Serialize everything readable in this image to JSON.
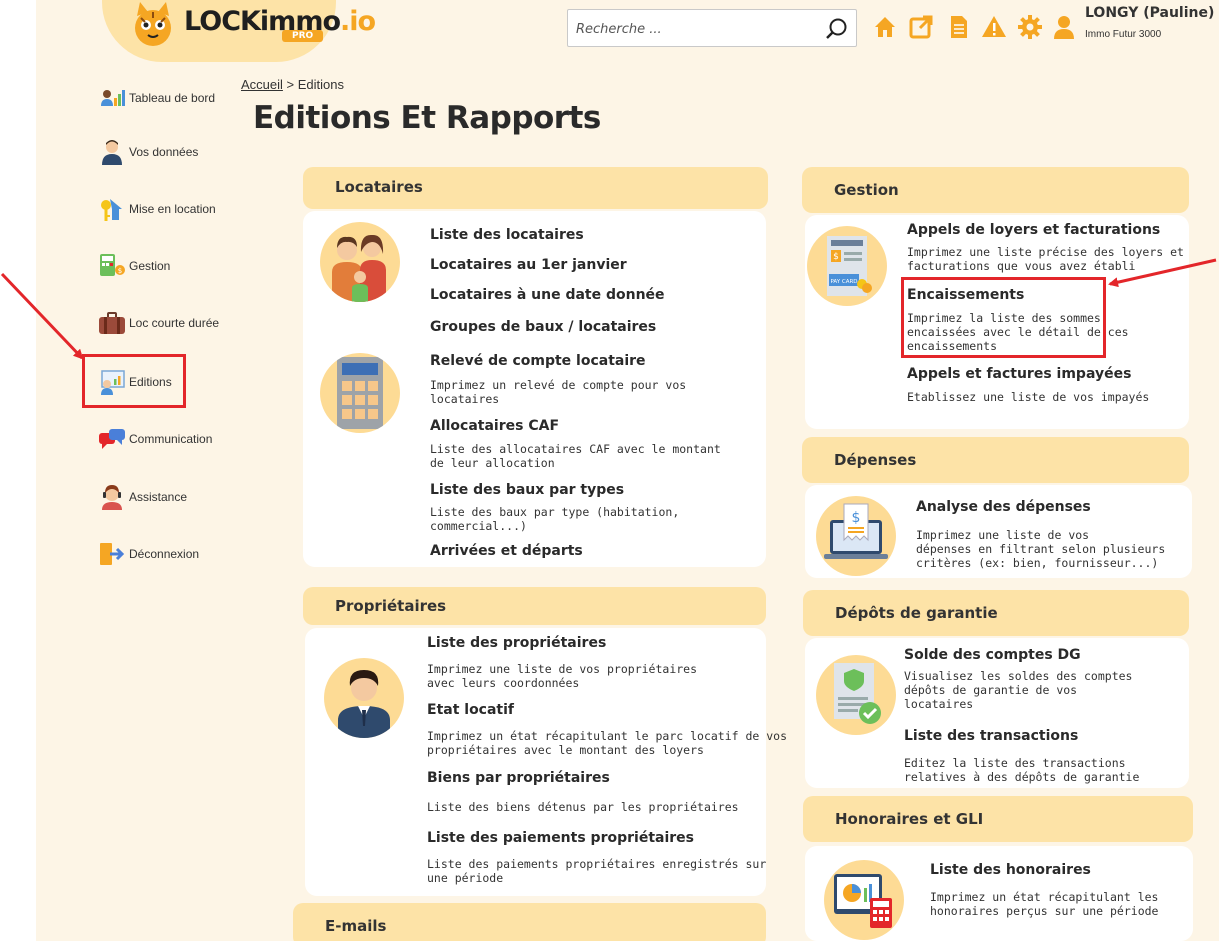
{
  "header": {
    "logo_text": "LOCKimmo",
    "logo_suffix": ".io",
    "logo_badge": "PRO",
    "search_placeholder": "Recherche ...",
    "user_name": "LONGY (Pauline)",
    "user_company": "Immo Futur 3000",
    "icons": [
      "home-icon",
      "external-link-icon",
      "document-icon",
      "alert-triangle-icon",
      "gear-icon",
      "user-icon"
    ]
  },
  "sidebar": {
    "items": [
      {
        "label": "Tableau de bord",
        "icon": "dashboard-icon"
      },
      {
        "label": "Vos données",
        "icon": "user-avatar-icon"
      },
      {
        "label": "Mise en location",
        "icon": "house-key-icon"
      },
      {
        "label": "Gestion",
        "icon": "calculator-coins-icon"
      },
      {
        "label": "Loc courte durée",
        "icon": "suitcase-icon"
      },
      {
        "label": "Editions",
        "icon": "report-chart-icon"
      },
      {
        "label": "Communication",
        "icon": "chat-bubbles-icon"
      },
      {
        "label": "Assistance",
        "icon": "support-agent-icon"
      },
      {
        "label": "Déconnexion",
        "icon": "logout-icon"
      }
    ]
  },
  "breadcrumb": {
    "home": "Accueil",
    "separator": ">",
    "current": "Editions"
  },
  "page_title": "Editions Et Rapports",
  "locataires": {
    "title": "Locataires",
    "items": [
      {
        "title": "Liste des locataires"
      },
      {
        "title": "Locataires au 1er janvier"
      },
      {
        "title": "Locataires à une date donnée"
      },
      {
        "title": "Groupes de baux / locataires"
      },
      {
        "title": "Relevé de compte locataire",
        "desc1": "Imprimez un relevé de compte pour vos",
        "desc2": "locataires"
      },
      {
        "title": "Allocataires CAF",
        "desc1": "Liste des allocataires CAF avec le montant",
        "desc2": "de leur allocation"
      },
      {
        "title": "Liste des baux par types",
        "desc1": "Liste des baux par type (habitation,",
        "desc2": "commercial...)"
      },
      {
        "title": "Arrivées et départs"
      }
    ]
  },
  "proprietaires": {
    "title": "Propriétaires",
    "items": [
      {
        "title": "Liste des propriétaires",
        "desc1": "Imprimez une liste de vos propriétaires",
        "desc2": "avec leurs coordonnées"
      },
      {
        "title": "Etat locatif",
        "desc1": "Imprimez un état récapitulant le parc locatif de vos",
        "desc2": "propriétaires avec le montant des loyers"
      },
      {
        "title": "Biens par propriétaires",
        "desc1": "Liste des biens détenus par les propriétaires"
      },
      {
        "title": "Liste des paiements propriétaires",
        "desc1": "Liste des paiements propriétaires enregistrés sur",
        "desc2": "une période"
      }
    ]
  },
  "emails": {
    "title": "E-mails"
  },
  "gestion": {
    "title": "Gestion",
    "items": [
      {
        "title": "Appels de loyers et facturations",
        "desc1": "Imprimez une liste précise des loyers et",
        "desc2": "facturations que vous avez établi"
      },
      {
        "title": "Encaissements",
        "desc1": "Imprimez la liste des sommes",
        "desc2": "encaissées avec le détail de ces",
        "desc3": "encaissements"
      },
      {
        "title": "Appels et factures impayées",
        "desc1": "Etablissez une liste de vos impayés"
      }
    ]
  },
  "depenses": {
    "title": "Dépenses",
    "items": [
      {
        "title": "Analyse des dépenses",
        "desc1": "Imprimez une liste de vos",
        "desc2": "dépenses en filtrant selon plusieurs",
        "desc3": "critères (ex: bien, fournisseur...)"
      }
    ]
  },
  "depots": {
    "title": "Dépôts de garantie",
    "items": [
      {
        "title": "Solde des comptes DG",
        "desc1": "Visualisez les soldes des comptes",
        "desc2": "dépôts de garantie de vos",
        "desc3": "locataires"
      },
      {
        "title": "Liste des transactions",
        "desc1": "Editez la liste des transactions",
        "desc2": "relatives à des dépôts de garantie"
      }
    ]
  },
  "honoraires": {
    "title": "Honoraires et GLI",
    "items": [
      {
        "title": "Liste des honoraires",
        "desc1": "Imprimez un état récapitulant les",
        "desc2": "honoraires perçus sur une période"
      }
    ]
  },
  "colors": {
    "accent": "#f5a623",
    "section_header": "#fde3a7",
    "page_bg": "#fdf5e6",
    "highlight": "#e3262a"
  }
}
